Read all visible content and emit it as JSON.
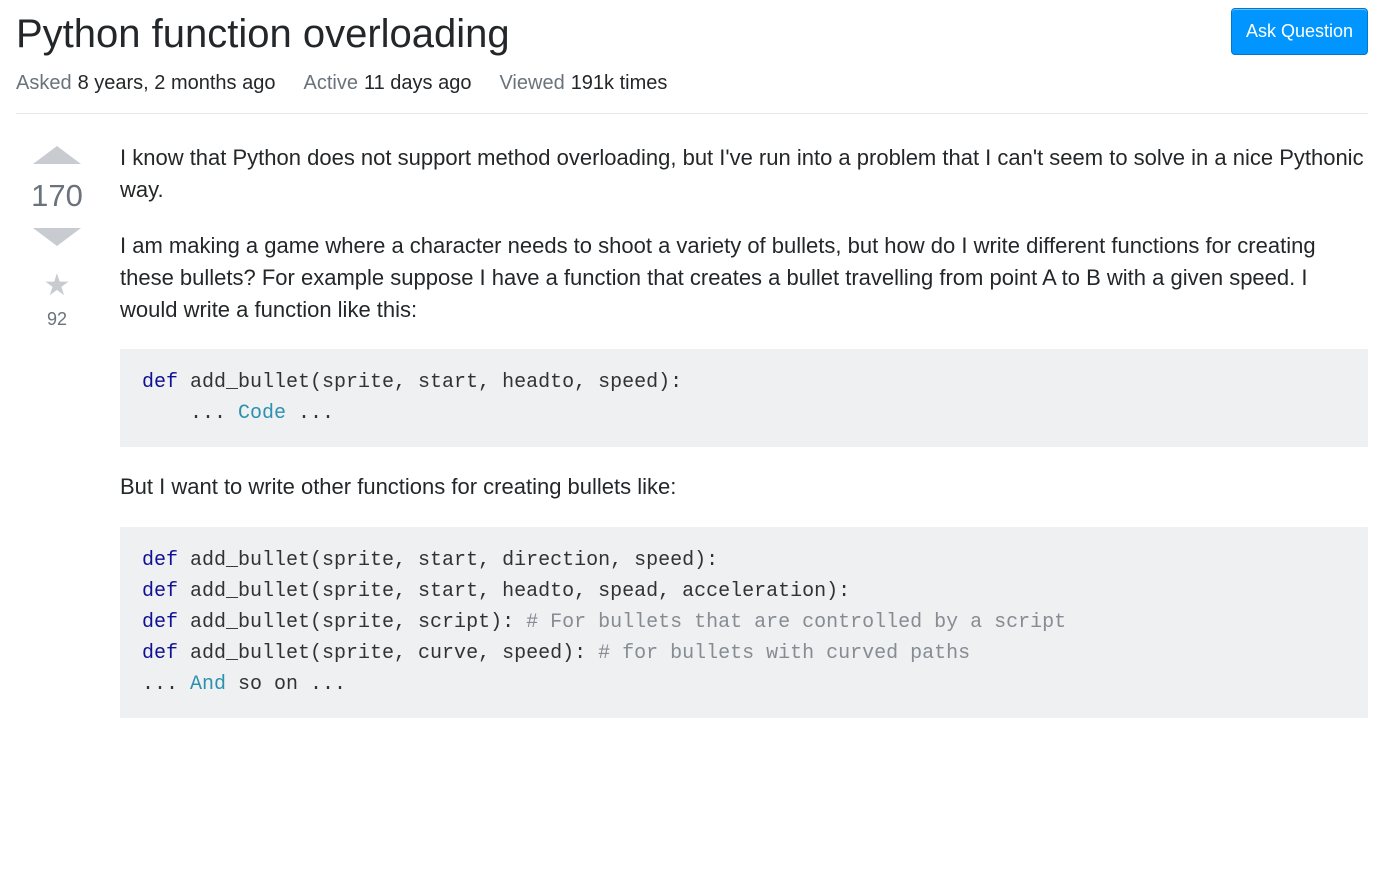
{
  "header": {
    "title": "Python function overloading",
    "ask_button": "Ask Question"
  },
  "meta": {
    "asked_label": "Asked",
    "asked_value": "8 years, 2 months ago",
    "active_label": "Active",
    "active_value": "11 days ago",
    "viewed_label": "Viewed",
    "viewed_value": "191k times"
  },
  "votes": {
    "score": "170",
    "favorites": "92"
  },
  "body": {
    "p1": "I know that Python does not support method overloading, but I've run into a problem that I can't seem to solve in a nice Pythonic way.",
    "p2": "I am making a game where a character needs to shoot a variety of bullets, but how do I write different functions for creating these bullets? For example suppose I have a function that creates a bullet travelling from point A to B with a given speed. I would write a function like this:",
    "p3": "But I want to write other functions for creating bullets like:"
  },
  "code1": {
    "l1_kw": "def",
    "l1_rest": " add_bullet(sprite, start, headto, speed):",
    "l2_a": "    ... ",
    "l2_cls": "Code",
    "l2_b": " ..."
  },
  "code2": {
    "l1_kw": "def",
    "l1_rest": " add_bullet(sprite, start, direction, speed):",
    "l2_kw": "def",
    "l2_rest": " add_bullet(sprite, start, headto, spead, acceleration):",
    "l3_kw": "def",
    "l3_rest": " add_bullet(sprite, script): ",
    "l3_com": "# For bullets that are controlled by a script",
    "l4_kw": "def",
    "l4_rest": " add_bullet(sprite, curve, speed): ",
    "l4_com": "# for bullets with curved paths",
    "l5_a": "... ",
    "l5_cls": "And",
    "l5_b": " so on ..."
  }
}
